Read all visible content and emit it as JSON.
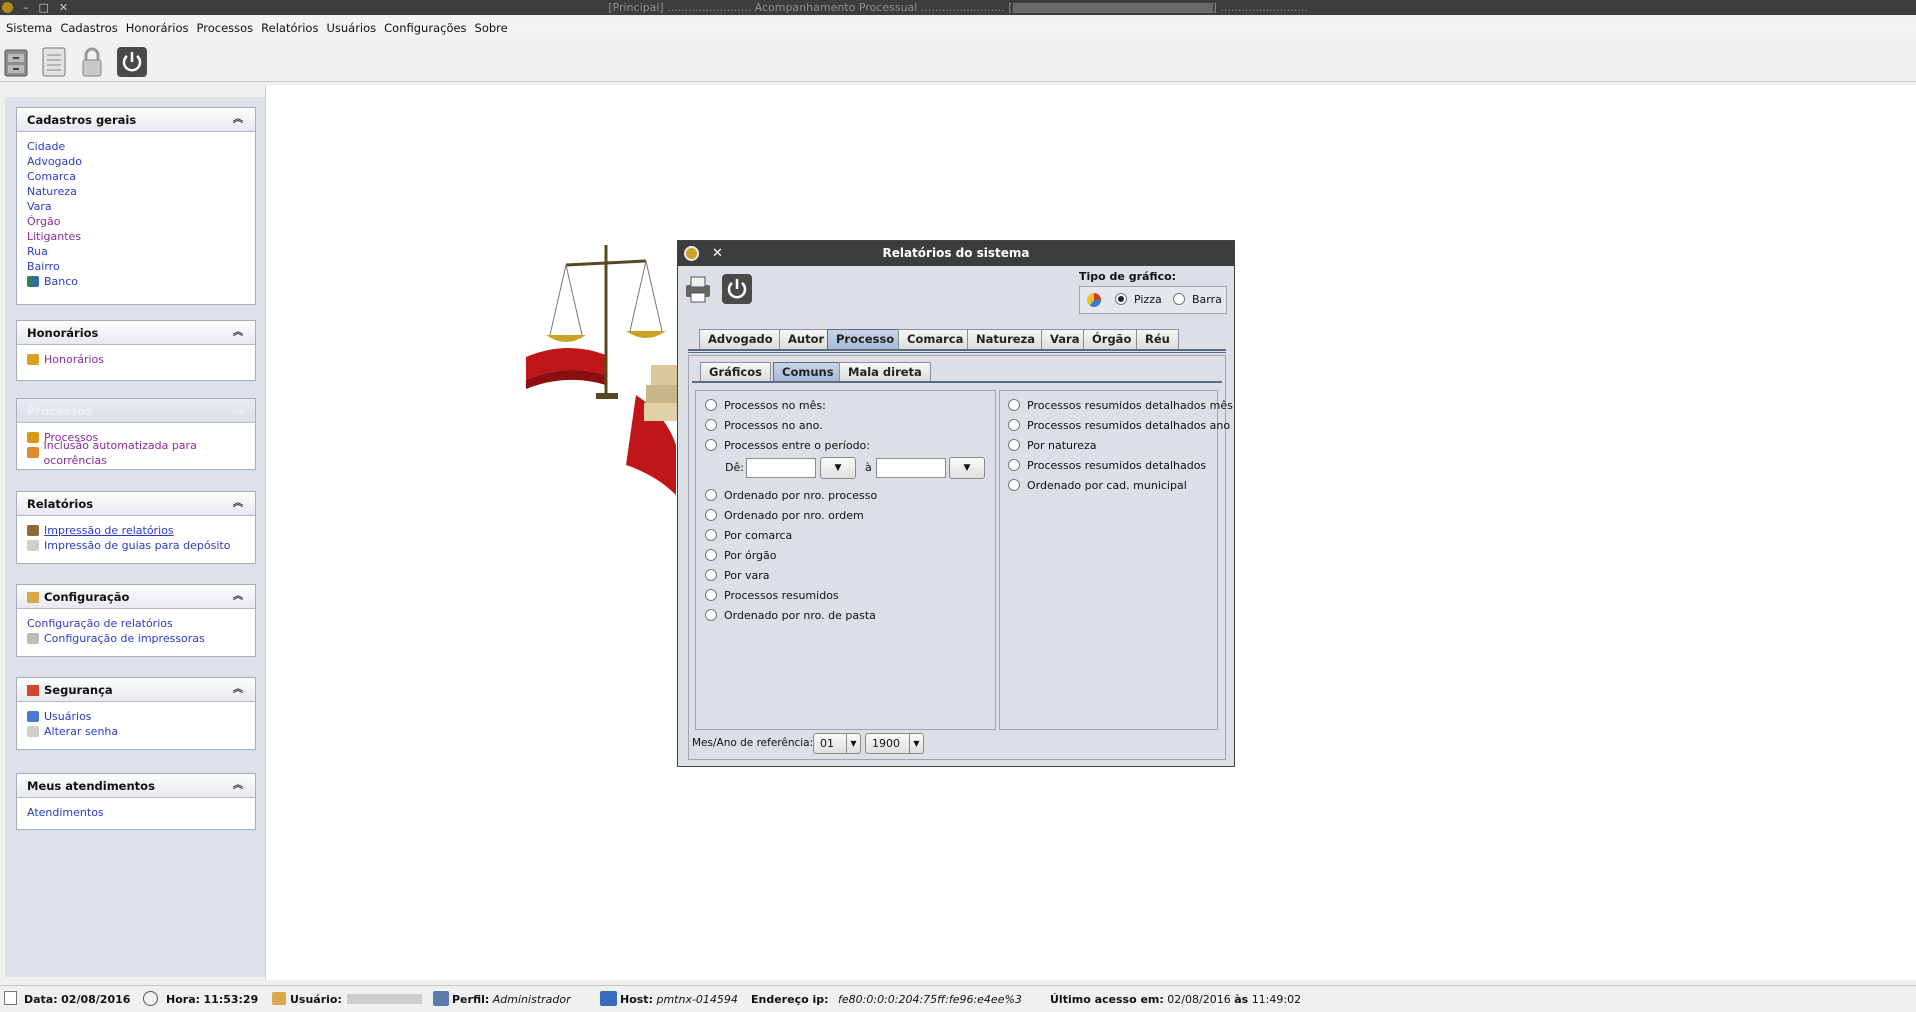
{
  "window": {
    "title": "[Principal] ........................ Acompanhamento Processual ........................ [",
    "title_suffix": "] .........................",
    "controls": [
      "–",
      "□",
      "✕"
    ]
  },
  "menubar": {
    "items": [
      "Sistema",
      "Cadastros",
      "Honorários",
      "Processos",
      "Relatórios",
      "Usuários",
      "Configurações",
      "Sobre"
    ]
  },
  "toolbar": {
    "icons": [
      "cabinet-icon",
      "notepad-icon",
      "lock-icon",
      "power-icon"
    ]
  },
  "sidebar": {
    "cadastros": {
      "title": "Cadastros gerais",
      "items": [
        "Cidade",
        "Advogado",
        "Comarca",
        "Natureza",
        "Vara",
        "Órgão",
        "Litigantes",
        "Rua",
        "Bairro",
        "Banco"
      ]
    },
    "honorarios": {
      "title": "Honorários",
      "items": [
        "Honorários"
      ]
    },
    "processos": {
      "title": "Processos",
      "items": [
        "Processos",
        "Inclusão automatizada para ocorrências"
      ]
    },
    "relatorios": {
      "title": "Relatórios",
      "items": [
        "Impressão de relatórios",
        "Impressão de guias para depósito"
      ]
    },
    "configuracao": {
      "title": "Configuração",
      "items": [
        "Configuração de relatórios",
        "Configuração de impressoras"
      ]
    },
    "seguranca": {
      "title": "Segurança",
      "items": [
        "Usuários",
        "Alterar senha"
      ]
    },
    "atendimentos": {
      "title": "Meus atendimentos",
      "items": [
        "Atendimentos"
      ]
    }
  },
  "dialog": {
    "title": "Relatórios do sistema",
    "close": "✕",
    "chart_type": {
      "label": "Tipo de gráfico:",
      "options": [
        "Pizza",
        "Barra"
      ],
      "selected": "Pizza"
    },
    "tabs": [
      "Advogado",
      "Autor",
      "Processo",
      "Comarca",
      "Natureza",
      "Vara",
      "Órgão",
      "Réu"
    ],
    "active_tab": "Processo",
    "subtabs": [
      "Gráficos",
      "Comuns",
      "Mala direta"
    ],
    "active_subtab": "Comuns",
    "left_options": [
      "Processos no mês:",
      "Processos no ano.",
      "Processos entre o período:",
      "Ordenado por nro. processo",
      "Ordenado por nro. ordem",
      "Por comarca",
      "Por órgão",
      "Por vara",
      "Processos resumidos",
      "Ordenado por nro. de pasta"
    ],
    "period": {
      "from_label": "Dê:",
      "to_label": "à",
      "from_value": "",
      "to_value": ""
    },
    "right_options": [
      "Processos resumidos detalhados mês",
      "Processos resumidos detalhados ano",
      "Por natureza",
      "Processos resumidos detalhados",
      "Ordenado por cad. municipal"
    ],
    "ref": {
      "label": "Mes/Ano de referência:",
      "month": "01",
      "year": "1900"
    }
  },
  "status": {
    "data_label": "Data:",
    "data": "02/08/2016",
    "hora_label": "Hora:",
    "hora": "11:53:29",
    "usuario_label": "Usuário:",
    "perfil_label": "Perfil:",
    "perfil": "Administrador",
    "host_label": "Host:",
    "host": "pmtnx-014594",
    "ip_label": "Endereço ip:",
    "ip": "fe80:0:0:0:204:75ff:fe96:e4ee%3",
    "acesso_label": "Último acesso em:",
    "acesso_data": "02/08/2016",
    "acesso_as": "às",
    "acesso_hora": "11:49:02"
  },
  "colors": {
    "titlebar": "#3d3d3d",
    "link": "#2a3bc7",
    "link_visited": "#8a2a9b",
    "sidebar_bg": "#dde1e8",
    "dialog_bg": "#dcdfe6",
    "tab_selected": "#b3c3dc"
  }
}
